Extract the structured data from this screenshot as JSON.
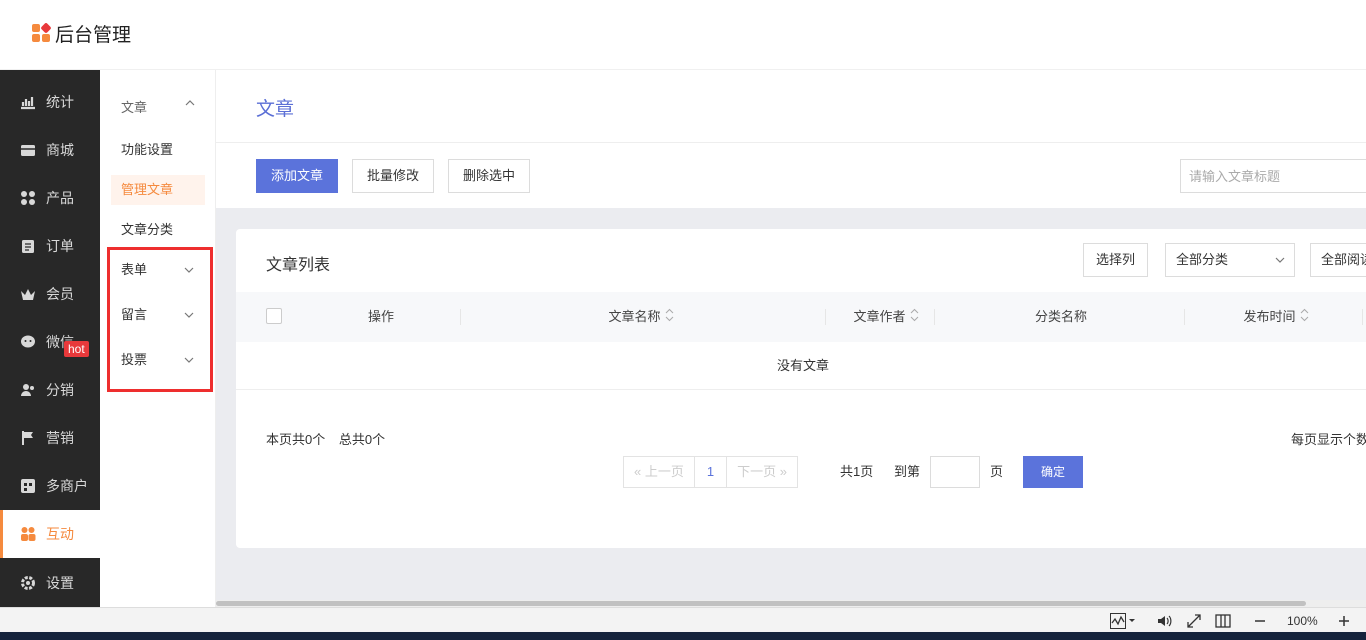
{
  "app": {
    "title": "后台管理"
  },
  "colors": {
    "accent": "#f58a3e",
    "primary": "#5b73db",
    "sidebar_bg": "#282828",
    "highlight_box": "#ee2e2e",
    "hot_badge": "#e8393b"
  },
  "sidebar": {
    "items": [
      {
        "label": "统计",
        "icon": "chart-icon"
      },
      {
        "label": "商城",
        "icon": "mail-icon"
      },
      {
        "label": "产品",
        "icon": "grid-icon"
      },
      {
        "label": "订单",
        "icon": "clipboard-icon"
      },
      {
        "label": "会员",
        "icon": "crown-icon"
      },
      {
        "label": "微信",
        "icon": "chat-icon"
      },
      {
        "label": "分销",
        "icon": "users-icon"
      },
      {
        "label": "营销",
        "icon": "flag-icon"
      },
      {
        "label": "多商户",
        "icon": "store-icon"
      },
      {
        "label": "互动",
        "icon": "people-icon"
      },
      {
        "label": "设置",
        "icon": "gear-icon"
      }
    ],
    "active_index": 9,
    "hot_badge": "hot"
  },
  "subnav": {
    "head": "文章",
    "items": [
      "功能设置",
      "管理文章",
      "文章分类"
    ],
    "active_index": 1,
    "groups": [
      "表单",
      "留言",
      "投票"
    ]
  },
  "page": {
    "title": "文章"
  },
  "toolbar": {
    "add_label": "添加文章",
    "batch_label": "批量修改",
    "delete_label": "删除选中",
    "search_placeholder": "请输入文章标题"
  },
  "list": {
    "title": "文章列表",
    "select_columns": "选择列",
    "category_filter": "全部分类",
    "read_filter": "全部阅读",
    "columns": [
      "操作",
      "文章名称",
      "文章作者",
      "分类名称",
      "发布时间"
    ],
    "empty_text": "没有文章",
    "page_count_text": "本页共0个",
    "total_text": "总共0个",
    "per_page_text": "每页显示个数"
  },
  "pager": {
    "prev": "上一页",
    "current": "1",
    "next": "下一页",
    "total_pages": "共1页",
    "goto_label": "到第",
    "page_unit": "页",
    "confirm": "确定"
  },
  "statusbar": {
    "zoom": "100%"
  }
}
